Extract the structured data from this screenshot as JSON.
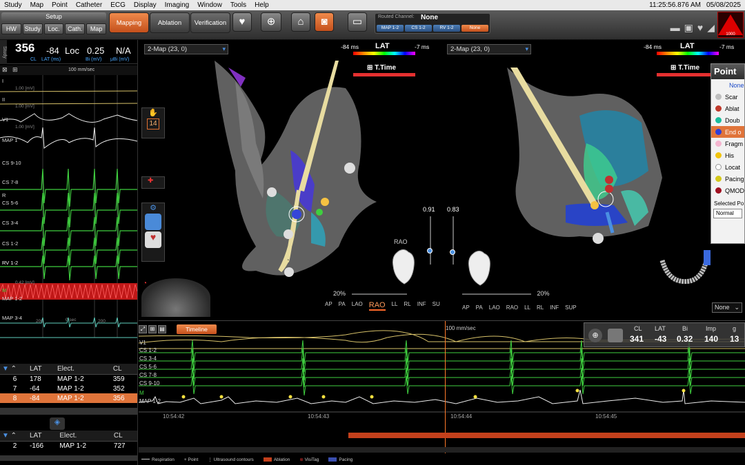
{
  "menubar": {
    "items": [
      "Study",
      "Map",
      "Point",
      "Catheter",
      "ECG",
      "Display",
      "Imaging",
      "Window",
      "Tools",
      "Help"
    ],
    "clock": "11:25:56.876 AM",
    "date": "05/08/2025"
  },
  "toolbar": {
    "setup_title": "Setup",
    "setup_buttons": [
      "HW",
      "Study",
      "Loc.",
      "Cath.",
      "Map"
    ],
    "modes": [
      "Mapping",
      "Ablation",
      "Verification"
    ],
    "active_mode": "Mapping",
    "routed_channel": {
      "label": "Routed Channel:",
      "value": "None",
      "channels": [
        "MAP 1-2",
        "CS 1-2",
        "RV 1-2",
        "None"
      ]
    },
    "battery_value": "1000"
  },
  "vitals": {
    "cl_value": "356",
    "cl_label": "CL",
    "lat_value": "-84",
    "lat_label": "LAT (ms)",
    "loc_value": "Loc",
    "bi_value": "0.25",
    "bi_label": "Bi (mV)",
    "ubi_value": "N/A",
    "ubi_label": "μBi (mV)",
    "side_tab": "Study"
  },
  "ecg": {
    "speed": "100 mm/sec",
    "leads": [
      "I",
      "II",
      "V1",
      "MAP 1",
      "CS 9-10",
      "CS 7-8",
      "R",
      "CS 5-6",
      "CS 3-4",
      "CS 1-2",
      "RV 1-2",
      "M",
      "MAP 1-2",
      "MAP 3-4"
    ],
    "scales": [
      "1.00 [mV]",
      "1.00 [mV]",
      "1.00 [mV]",
      "0.42 [mV]"
    ],
    "time_marks": [
      "200",
      "0 sec",
      "200"
    ]
  },
  "point_table": {
    "headers": [
      "LAT",
      "Elect.",
      "CL"
    ],
    "rows": [
      {
        "id": "6",
        "lat": "178",
        "elect": "MAP 1-2",
        "cl": "359"
      },
      {
        "id": "7",
        "lat": "-64",
        "elect": "MAP 1-2",
        "cl": "352"
      },
      {
        "id": "8",
        "lat": "-84",
        "elect": "MAP 1-2",
        "cl": "356"
      }
    ],
    "selected_index": 2
  },
  "point_table2": {
    "headers": [
      "LAT",
      "Elect.",
      "CL"
    ],
    "rows": [
      {
        "id": "2",
        "lat": "-166",
        "elect": "MAP 1-2",
        "cl": "727"
      }
    ]
  },
  "map1": {
    "title": "2-Map (23, 0)",
    "lat_label": "LAT",
    "lat_min": "-84 ms",
    "lat_max": "-7 ms",
    "ttime": "T.Time",
    "slider_value": "0.91",
    "zoom": "20%",
    "view_label": "RAO",
    "views": [
      "AP",
      "PA",
      "LAO",
      "RAO",
      "LL",
      "RL",
      "INF",
      "SUP"
    ],
    "active_view": "RAO",
    "sidebar_counter": "14"
  },
  "map2": {
    "title": "2-Map (23, 0)",
    "lat_label": "LAT",
    "lat_min": "-84 ms",
    "lat_max": "-7 ms",
    "ttime": "T.Time",
    "slider_value": "0.83",
    "zoom": "20%",
    "views": [
      "AP",
      "PA",
      "LAO",
      "RAO",
      "LL",
      "RL",
      "INF",
      "SUP"
    ],
    "none_dropdown": "None"
  },
  "point_panel": {
    "title": "Point",
    "none_label": "None",
    "types": [
      {
        "label": "Scar",
        "color": "#bfbfbf"
      },
      {
        "label": "Ablat",
        "color": "#c0392b"
      },
      {
        "label": "Doub",
        "color": "#1abc9c"
      },
      {
        "label": "End o",
        "color": "#2c3ed8"
      },
      {
        "label": "Fragm",
        "color": "#f5b6d0"
      },
      {
        "label": "His",
        "color": "#f1c40f"
      },
      {
        "label": "Locat",
        "color": "#ffffff"
      },
      {
        "label": "Pacing",
        "color": "#d4c81a"
      },
      {
        "label": "QMOD",
        "color": "#a01020"
      }
    ],
    "selected_type": "End o",
    "selected_point_label": "Selected Po",
    "selected_point_value": "Normal"
  },
  "bottom": {
    "timeline_label": "Timeline",
    "speed": "100 mm/sec",
    "signals": [
      "V1",
      "CS 1-2",
      "CS 3-4",
      "CS 5-6",
      "CS 7-8",
      "CS 9-10",
      "M",
      "MAP 1-2"
    ],
    "times": [
      "10:54:42",
      "10:54:43",
      "10:54:44",
      "10:54:45"
    ],
    "readout": {
      "headers": [
        "CL",
        "LAT",
        "Bi",
        "Imp",
        "g"
      ],
      "values": [
        "341",
        "-43",
        "0.32",
        "140",
        "13"
      ]
    },
    "legend": [
      "Respiration",
      "Point",
      "Ultrasound contours",
      "Ablation",
      "VisiTag",
      "Pacing"
    ],
    "legend_colors": [
      "#cccccc",
      "#cccccc",
      "#cccccc",
      "#c4401c",
      "#c4401c",
      "#3b4fb0"
    ]
  }
}
